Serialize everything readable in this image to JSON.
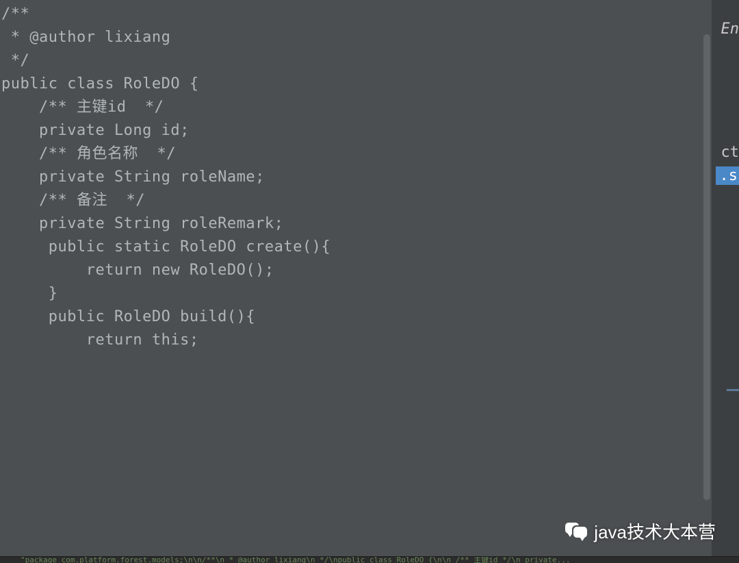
{
  "code": {
    "lines": [
      "/**",
      " * @author lixiang",
      " */",
      "public class RoleDO {",
      "",
      "",
      "    /** 主键id  */",
      "    private Long id;",
      "",
      "    /** 角色名称  */",
      "    private String roleName;",
      "",
      "    /** 备注  */",
      "    private String roleRemark;",
      "",
      "",
      "",
      "",
      "     public static RoleDO create(){",
      "         return new RoleDO();",
      "     }",
      "",
      "     public RoleDO build(){",
      "         return this;"
    ]
  },
  "right": {
    "hint_en": "En",
    "hint_ct": "ct",
    "hint_s": ".s"
  },
  "watermark": {
    "text": "java技术大本营"
  },
  "bottom": {
    "text": "\"package com.platform.forest.models;\\n\\n/**\\n * @author lixiang\\n */\\npublic class RoleDO {\\n\\n    /** 主键id  */\\n    private..."
  }
}
